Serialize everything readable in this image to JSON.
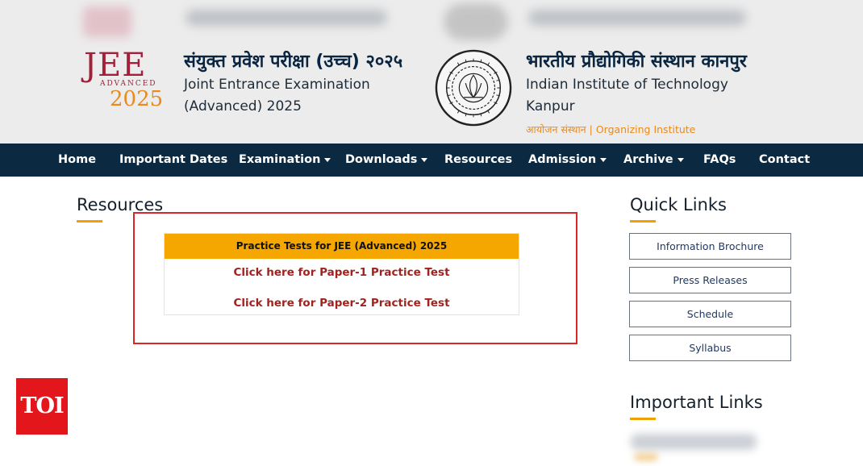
{
  "header": {
    "jee_logo": {
      "word": "JEE",
      "sub": "ADVANCED",
      "year": "2025"
    },
    "title_hindi": "संयुक्त प्रवेश परीक्षा (उच्च) २०२५",
    "title_english_line1": "Joint Entrance Examination",
    "title_english_line2": "(Advanced) 2025",
    "institute_hindi": "भारतीय प्रौद्योगिकी संस्थान कानपुर",
    "institute_english_line1": "Indian Institute of Technology",
    "institute_english_line2": "Kanpur",
    "organizing_label": "आयोजन संस्थान | Organizing Institute",
    "seal_icon": "iit-kanpur-seal-icon"
  },
  "nav": {
    "items": [
      {
        "label": "Home",
        "dropdown": false
      },
      {
        "label": "Important Dates",
        "dropdown": false
      },
      {
        "label": "Examination",
        "dropdown": true
      },
      {
        "label": "Downloads",
        "dropdown": true
      },
      {
        "label": "Resources",
        "dropdown": false
      },
      {
        "label": "Admission",
        "dropdown": true
      },
      {
        "label": "Archive",
        "dropdown": true
      },
      {
        "label": "FAQs",
        "dropdown": false
      },
      {
        "label": "Contact",
        "dropdown": false
      }
    ]
  },
  "main": {
    "section_title": "Resources",
    "practice": {
      "heading": "Practice Tests for JEE (Advanced) 2025",
      "links": [
        "Click here for Paper-1 Practice Test",
        "Click here for Paper-2 Practice Test"
      ]
    }
  },
  "sidebar": {
    "quick_links_title": "Quick Links",
    "quick_links": [
      "Information Brochure",
      "Press Releases",
      "Schedule",
      "Syllabus"
    ],
    "important_links_title": "Important Links"
  },
  "watermark": {
    "label": "TOI"
  },
  "colors": {
    "nav_bg": "#0b2a42",
    "accent_orange": "#f5a700",
    "link_red": "#a1221f",
    "highlight_red": "#dc2626",
    "jee_maroon": "#a2203a"
  }
}
